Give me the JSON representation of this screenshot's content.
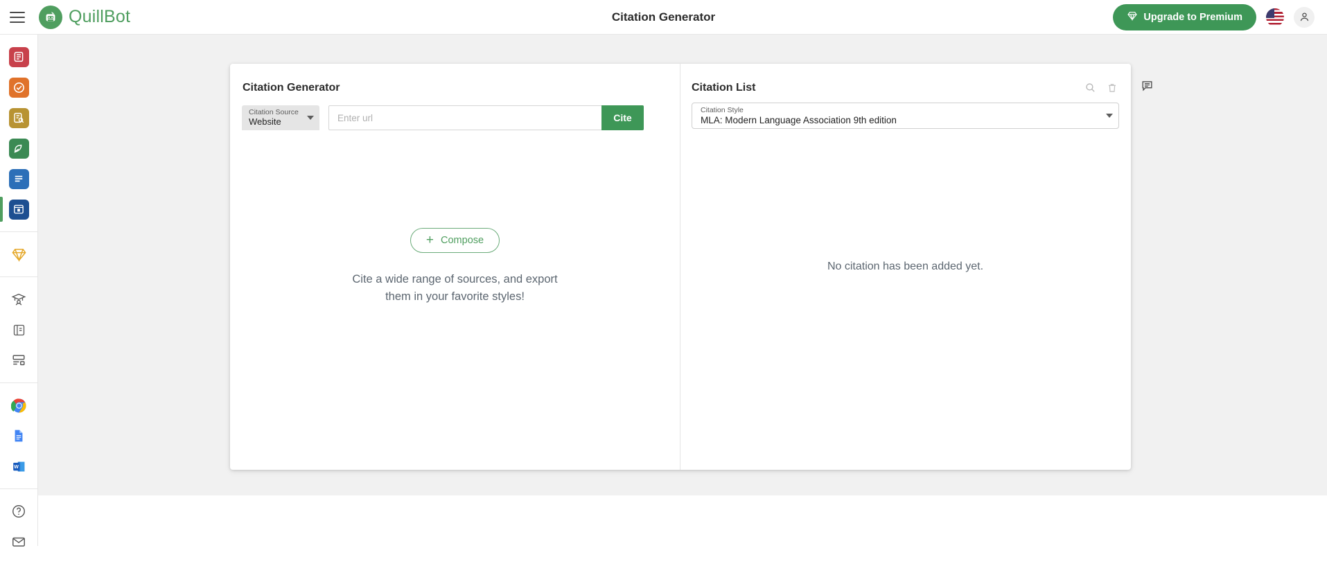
{
  "header": {
    "menu_icon": "hamburger-icon",
    "brand": {
      "part1": "Quill",
      "part2": "Bot"
    },
    "title": "Citation Generator",
    "upgrade_label": "Upgrade to Premium",
    "upgrade_icon": "diamond-icon",
    "flag_icon": "us-flag-icon",
    "account_icon": "account-avatar-icon",
    "accent_green": "#3e9757"
  },
  "sidebar": {
    "groups": [
      {
        "items": [
          {
            "name": "paraphraser",
            "icon": "paraphraser-icon",
            "color": "#c8414b",
            "active": false
          },
          {
            "name": "grammar-checker",
            "icon": "grammar-checker-icon",
            "color": "#e0722a",
            "active": false
          },
          {
            "name": "plagiarism-checker",
            "icon": "plagiarism-checker-icon",
            "color": "#b89333",
            "active": false
          },
          {
            "name": "co-writer",
            "icon": "co-writer-icon",
            "color": "#3b8a54",
            "active": false
          },
          {
            "name": "summarizer",
            "icon": "summarizer-icon",
            "color": "#2c6fb8",
            "active": false
          },
          {
            "name": "citation-generator",
            "icon": "citation-generator-icon",
            "color": "#1d4f91",
            "active": true
          }
        ]
      },
      {
        "items": [
          {
            "name": "premium",
            "icon": "diamond-icon",
            "color": "#e5a829",
            "active": false
          }
        ]
      },
      {
        "items": [
          {
            "name": "student",
            "icon": "graduation-cap-icon",
            "color": "#5a5a5a",
            "active": false
          },
          {
            "name": "flashcards",
            "icon": "book-icon",
            "color": "#5a5a5a",
            "active": false
          },
          {
            "name": "translator",
            "icon": "translator-icon",
            "color": "#5a5a5a",
            "active": false
          }
        ]
      },
      {
        "items": [
          {
            "name": "chrome-extension",
            "icon": "chrome-icon",
            "color": "#4285f4",
            "active": false
          },
          {
            "name": "google-docs-addon",
            "icon": "google-docs-icon",
            "color": "#4285f4",
            "active": false
          },
          {
            "name": "ms-word-addin",
            "icon": "ms-word-icon",
            "color": "#185abd",
            "active": false
          }
        ]
      },
      {
        "items": [
          {
            "name": "help",
            "icon": "help-circle-icon",
            "color": "#5a5a5a",
            "active": false
          },
          {
            "name": "contact",
            "icon": "mail-icon",
            "color": "#5a5a5a",
            "active": false
          }
        ]
      }
    ]
  },
  "generator": {
    "title": "Citation Generator",
    "source_select": {
      "label": "Citation Source",
      "value": "Website",
      "caret_icon": "chevron-down-icon"
    },
    "url_input": {
      "placeholder": "Enter url",
      "value": ""
    },
    "cite_button": "Cite",
    "compose_button": "Compose",
    "compose_icon": "plus-icon",
    "empty_text_line1": "Cite a wide range of sources, and export",
    "empty_text_line2": "them in your favorite styles!"
  },
  "citation_list": {
    "title": "Citation List",
    "search_icon": "search-icon",
    "delete_icon": "trash-icon",
    "style_select": {
      "label": "Citation Style",
      "value": "MLA: Modern Language Association 9th edition",
      "caret_icon": "chevron-down-icon"
    },
    "empty_message": "No citation has been added yet."
  },
  "feedback": {
    "icon": "feedback-chat-icon"
  }
}
